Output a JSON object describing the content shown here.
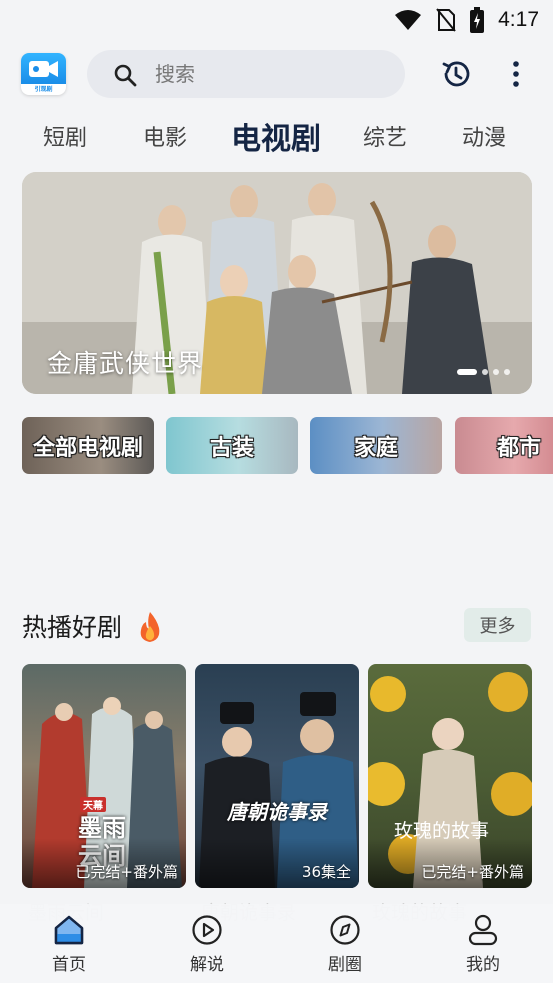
{
  "status_bar": {
    "time": "4:17"
  },
  "header": {
    "logo_text": "引观剧",
    "search_placeholder": "搜索"
  },
  "tabs": [
    {
      "label": "短剧"
    },
    {
      "label": "电影"
    },
    {
      "label": "电视剧",
      "active": true
    },
    {
      "label": "综艺"
    },
    {
      "label": "动漫"
    }
  ],
  "banner": {
    "title": "金庸武侠世界",
    "page_count": 5,
    "active_index": 0
  },
  "genres": [
    {
      "label": "全部电视剧"
    },
    {
      "label": "古装"
    },
    {
      "label": "家庭"
    },
    {
      "label": "都市"
    }
  ],
  "hot_section": {
    "title": "热播好剧",
    "more_label": "更多",
    "cards": [
      {
        "poster_title": "墨雨云间",
        "poster_tag": "天幕",
        "badge": "已完结+番外篇",
        "caption": "墨雨云间"
      },
      {
        "poster_title": "唐朝诡事录",
        "badge": "36集全",
        "caption": "唐朝诡事录"
      },
      {
        "poster_title": "玫瑰的故事",
        "badge": "已完结+番外篇",
        "caption": "玫瑰的故事"
      }
    ]
  },
  "bottom_nav": [
    {
      "label": "首页",
      "icon": "home-icon",
      "active": true
    },
    {
      "label": "解说",
      "icon": "play-circle-icon"
    },
    {
      "label": "剧圈",
      "icon": "compass-icon"
    },
    {
      "label": "我的",
      "icon": "user-icon"
    }
  ],
  "colors": {
    "accent_dark": "#142544",
    "accent_blue": "#2e8de6",
    "background": "#f3f4f6"
  }
}
